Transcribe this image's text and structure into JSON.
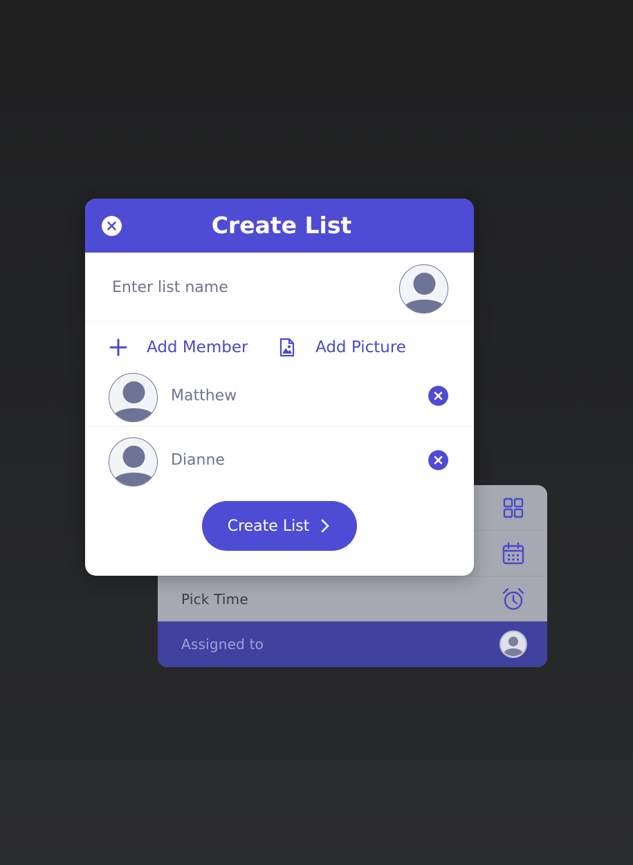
{
  "colors": {
    "accent": "#4E4CD5",
    "assigned_row": "#4141A0",
    "back_panel": "#A6A8B2",
    "avatar_fill": "#6D7495"
  },
  "back_panel": {
    "rows": [
      {
        "label": "",
        "icon": "grid-icon"
      },
      {
        "label": "",
        "icon": "calendar-icon"
      },
      {
        "label": "Pick Time",
        "icon": "alarm-clock-icon"
      },
      {
        "label": "Assigned to",
        "icon": "user-circle-icon"
      }
    ]
  },
  "modal": {
    "title": "Create List",
    "close_icon": "close-icon",
    "list_name": {
      "value": "",
      "placeholder": "Enter list name"
    },
    "actions": {
      "add_member": "Add Member",
      "add_picture": "Add Picture"
    },
    "members": [
      {
        "name": "Matthew"
      },
      {
        "name": "Dianne"
      }
    ],
    "submit_label": "Create List"
  }
}
